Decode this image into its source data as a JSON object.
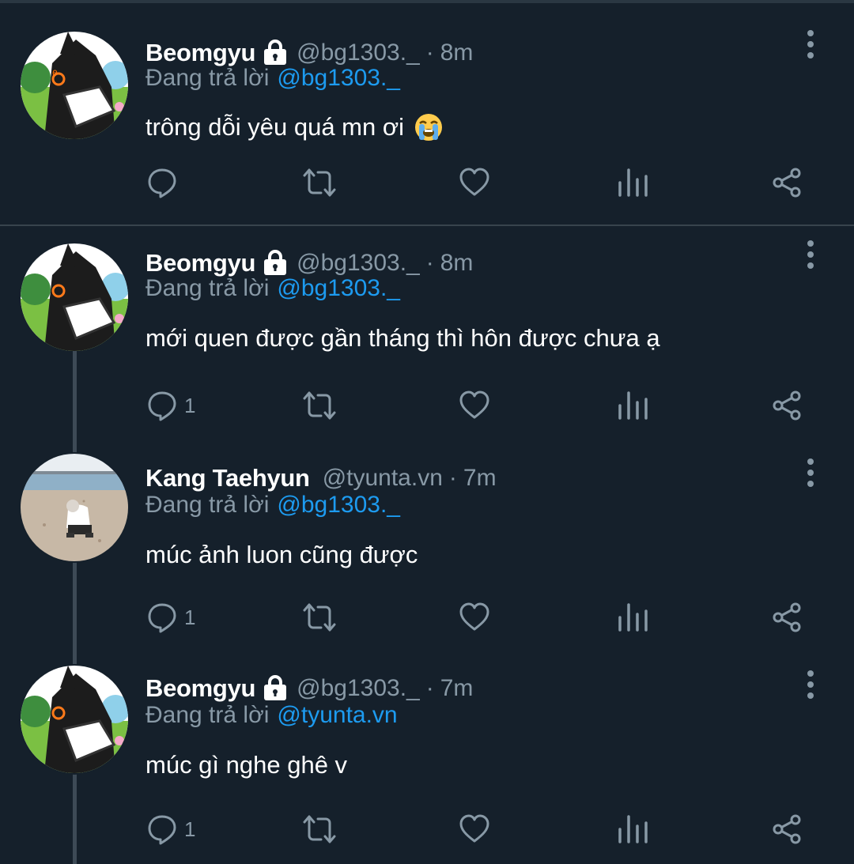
{
  "colors": {
    "background": "#15202b",
    "divider": "#38444d",
    "secondary_text": "#8899a6",
    "mention": "#1d9bf0",
    "primary_text": "#ffffff"
  },
  "tweets": [
    {
      "display_name": "Beomgyu",
      "protected": true,
      "handle": "@bg1303._",
      "separator": "·",
      "time": "8m",
      "reply_prefix": "Đang trả lời",
      "reply_to": "@bg1303._",
      "text": "trông dỗi yêu quá mn ơi",
      "emoji": "loudly-crying-face",
      "reply_count": "",
      "avatar": "cartoon-avatar"
    },
    {
      "display_name": "Beomgyu",
      "protected": true,
      "handle": "@bg1303._",
      "separator": "·",
      "time": "8m",
      "reply_prefix": "Đang trả lời",
      "reply_to": "@bg1303._",
      "text": "mới quen được gần tháng thì hôn được chưa ạ",
      "reply_count": "1",
      "avatar": "cartoon-avatar"
    },
    {
      "display_name": "Kang Taehyun",
      "protected": false,
      "handle": "@tyunta.vn",
      "separator": "·",
      "time": "7m",
      "reply_prefix": "Đang trả lời",
      "reply_to": "@bg1303._",
      "text": "múc ảnh luon cũng được",
      "reply_count": "1",
      "avatar": "beach-photo-avatar"
    },
    {
      "display_name": "Beomgyu",
      "protected": true,
      "handle": "@bg1303._",
      "separator": "·",
      "time": "7m",
      "reply_prefix": "Đang trả lời",
      "reply_to": "@tyunta.vn",
      "text": "múc gì nghe ghê v",
      "reply_count": "1",
      "avatar": "cartoon-avatar"
    }
  ]
}
